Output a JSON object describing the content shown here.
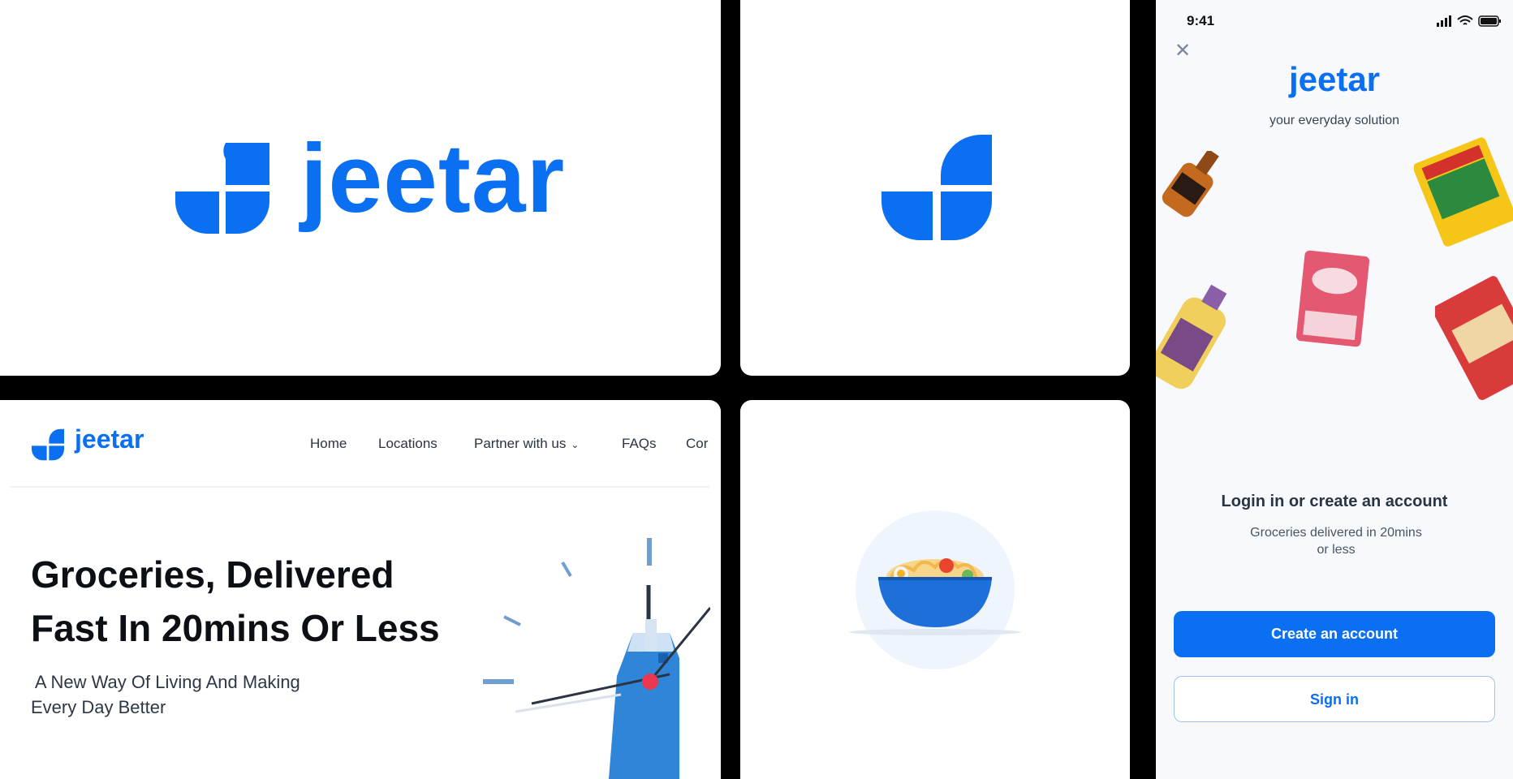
{
  "brand": {
    "name": "jeetar",
    "primary_color": "#0a6ff0",
    "logo_icon": "jeetar-quarter-circles-logo"
  },
  "web": {
    "nav": {
      "home": "Home",
      "locations": "Locations",
      "partner": "Partner with us",
      "faqs": "FAQs",
      "contact_partial": "Cor"
    },
    "hero": {
      "title_line1": "Groceries, Delivered",
      "title_line2": "Fast In 20mins Or Less",
      "subtitle_line1": " A New Way Of Living And Making",
      "subtitle_line2": "Every Day Better"
    }
  },
  "phone": {
    "status_time": "9:41",
    "tagline": "your everyday solution",
    "login_title": "Login in or create an account",
    "login_sub_line1": "Groceries delivered in 20mins",
    "login_sub_line2": "or less",
    "create_account": "Create an account",
    "sign_in": "Sign in",
    "icons": [
      "close-icon",
      "signal-icon",
      "wifi-icon",
      "battery-icon"
    ],
    "products": [
      "liquor-bottle",
      "noodles-pack",
      "cooking-oil-bottle",
      "yoghurt-pack",
      "macaroni-pack"
    ]
  },
  "illustrations": [
    "pasta-bowl",
    "milk-carton-clock"
  ]
}
